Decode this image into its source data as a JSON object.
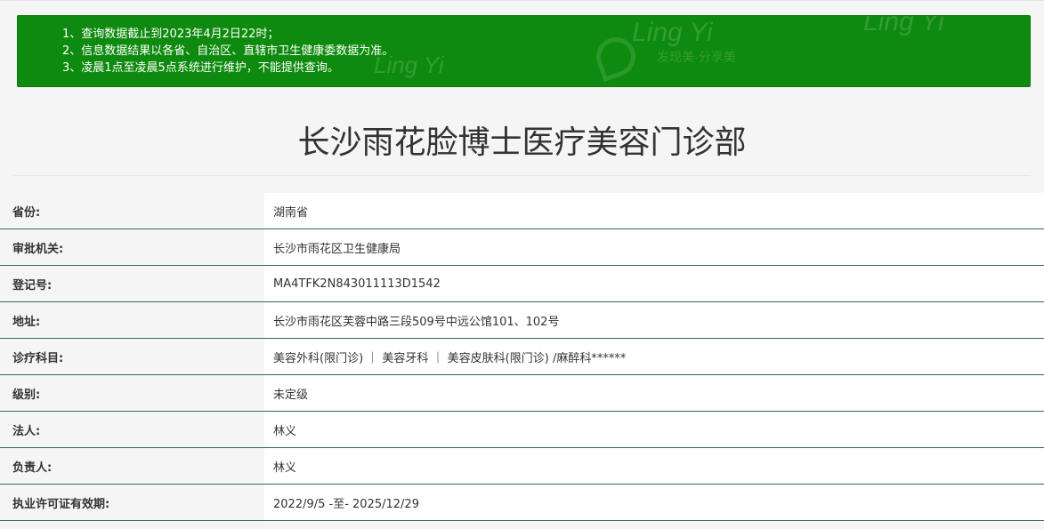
{
  "notice": {
    "items": [
      "1、查询数据截止到2023年4月2日22时；",
      "2、信息数据结果以各省、自治区、直辖市卫生健康委数据为准。",
      "3、凌晨1点至凌晨5点系统进行维护，不能提供查询。"
    ],
    "watermark_text": "Ling Yi",
    "watermark_tagline": "发现美·分享美"
  },
  "title": "长沙雨花脸博士医疗美容门诊部",
  "rows": [
    {
      "label": "省份:",
      "value": "湖南省"
    },
    {
      "label": "审批机关:",
      "value": "长沙市雨花区卫生健康局"
    },
    {
      "label": "登记号:",
      "value": "MA4TFK2N843011113D1542"
    },
    {
      "label": "地址:",
      "value": "长沙市雨花区芙蓉中路三段509号中远公馆101、102号"
    },
    {
      "label": "诊疗科目:",
      "value": "美容外科(限门诊) ｜ 美容牙科 ｜ 美容皮肤科(限门诊) /麻醉科******"
    },
    {
      "label": "级别:",
      "value": "未定级"
    },
    {
      "label": "法人:",
      "value": "林义"
    },
    {
      "label": "负责人:",
      "value": "林义"
    },
    {
      "label": "执业许可证有效期:",
      "value": "2022/9/5 -至- 2025/12/29"
    }
  ],
  "colors": {
    "notice_bg": "#0e8a0e",
    "row_divider": "#2f6e4a"
  }
}
